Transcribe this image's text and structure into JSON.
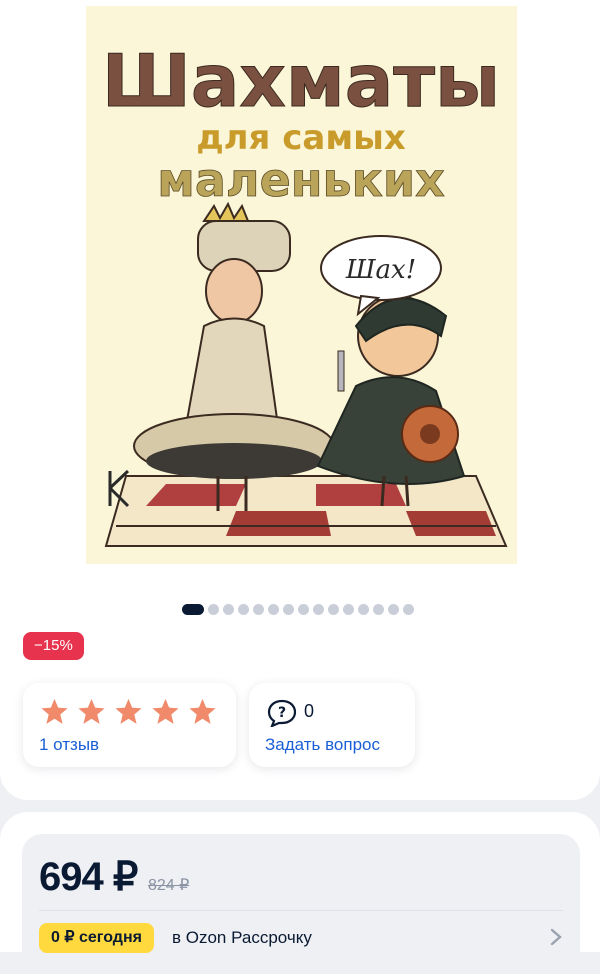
{
  "product": {
    "cover": {
      "title_lines": [
        "Шахматы",
        "для самых",
        "маленьких"
      ],
      "speech": "Шах!"
    },
    "gallery": {
      "count": 15,
      "active_index": 0
    },
    "discount_badge": "−15%",
    "rating": {
      "stars": 5,
      "reviews_label": "1 отзыв"
    },
    "questions": {
      "count": "0",
      "ask_label": "Задать вопрос"
    },
    "price": {
      "current": "694 ₽",
      "old": "824 ₽",
      "installment_badge": "0 ₽ сегодня",
      "installment_text": "в Ozon Рассрочку"
    }
  },
  "colors": {
    "accent_link": "#1a5fd6",
    "discount": "#e8334f",
    "star": "#f08a6b",
    "installment": "#ffd93d",
    "text_dark": "#0b1a33"
  },
  "icons": [
    "star-icon",
    "question-bubble-icon",
    "chevron-right-icon"
  ]
}
